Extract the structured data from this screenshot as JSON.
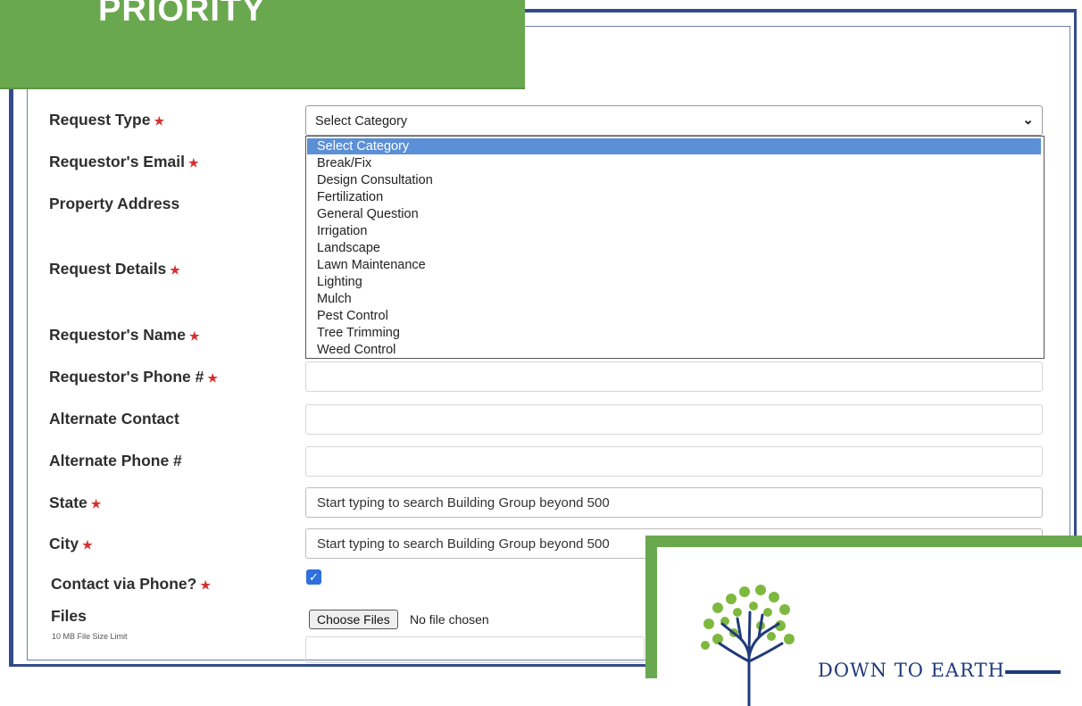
{
  "banner": {
    "title": "PRIORITY"
  },
  "form": {
    "labels": {
      "request_type": "Request Type",
      "requestor_email": "Requestor's Email",
      "property_address": "Property Address",
      "request_details": "Request Details",
      "requestor_name": "Requestor's Name",
      "requestor_phone": "Requestor's Phone #",
      "alternate_contact": "Alternate Contact",
      "alternate_phone": "Alternate Phone #",
      "state": "State",
      "city": "City",
      "contact_via_phone": "Contact via Phone?",
      "files": "Files"
    },
    "files_note": "10 MB File Size Limit",
    "request_type": {
      "selected": "Select Category",
      "options": [
        "Select Category",
        "Break/Fix",
        "Design Consultation",
        "Fertilization",
        "General Question",
        "Irrigation",
        "Landscape",
        "Lawn Maintenance",
        "Lighting",
        "Mulch",
        "Pest Control",
        "Tree Trimming",
        "Weed Control"
      ]
    },
    "state_placeholder": "Start typing to search Building Group beyond 500",
    "city_placeholder": "Start typing to search Building Group beyond 500",
    "contact_via_phone_checked": true,
    "file_button": "Choose Files",
    "file_status": "No file chosen"
  },
  "logo": {
    "text": "DOWN TO EARTH"
  },
  "colors": {
    "banner_green": "#6aa84f",
    "frame_blue": "#334a8c",
    "option_highlight": "#5b8fd6"
  }
}
